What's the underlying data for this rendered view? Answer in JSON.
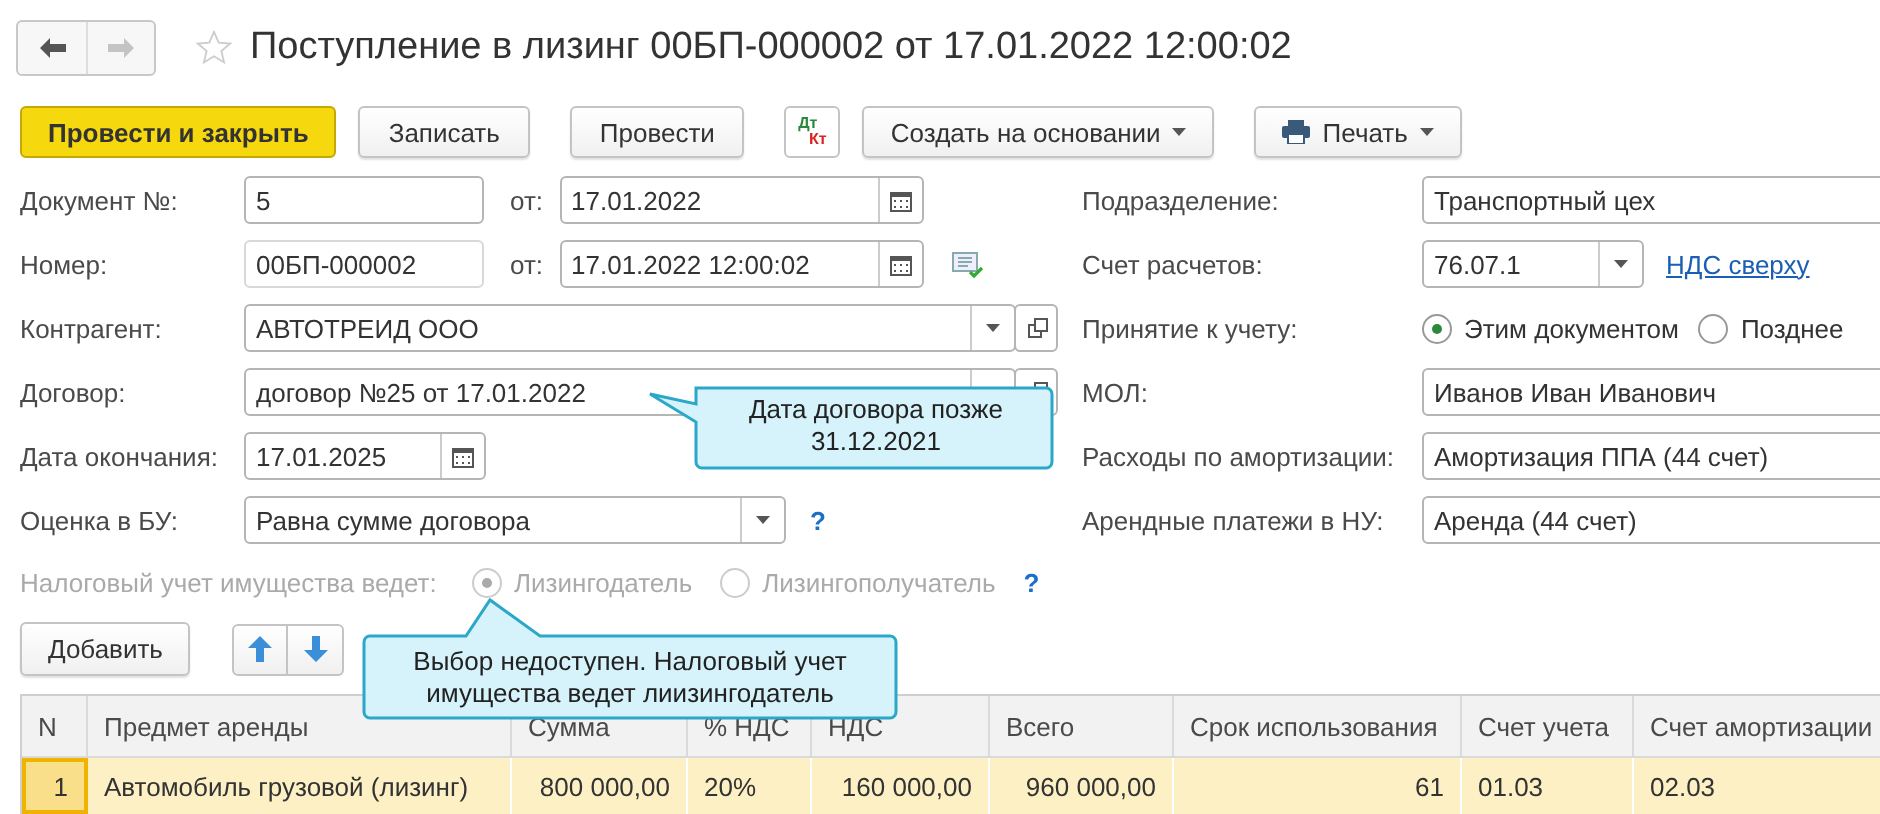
{
  "navigation": {
    "back_enabled": true,
    "forward_enabled": false
  },
  "favorite": false,
  "title": "Поступление в лизинг 00БП-000002 от 17.01.2022 12:00:02",
  "toolbar": [
    {
      "kind": "primary",
      "label": "Провести и закрыть"
    },
    {
      "kind": "plain",
      "label": "Записать"
    },
    {
      "kind": "plain",
      "label": "Провести"
    },
    {
      "kind": "dtkt",
      "lines": [
        "Дт",
        "Кт"
      ]
    },
    {
      "kind": "menu",
      "label": "Создать на основании"
    },
    {
      "kind": "print",
      "label": "Печать"
    }
  ],
  "left_fields": [
    {
      "kind": "doc_number",
      "label": "Документ №:",
      "value": "5",
      "date_label": "от:",
      "date": "17.01.2022"
    },
    {
      "kind": "number",
      "label": "Номер:",
      "value": "00БП-000002",
      "date_label": "от:",
      "date": "17.01.2022 12:00:02"
    },
    {
      "kind": "ref",
      "label": "Контрагент:",
      "value": "АВТОТРЕИД ООО"
    },
    {
      "kind": "ref",
      "label": "Договор:",
      "value": "договор №25 от 17.01.2022"
    },
    {
      "kind": "date",
      "label": "Дата окончания:",
      "value": "17.01.2025"
    },
    {
      "kind": "select",
      "label": "Оценка в БУ:",
      "value": "Равна сумме договора",
      "help": "?"
    }
  ],
  "right_fields": [
    {
      "kind": "input",
      "label": "Подразделение:",
      "value": "Транспортный цех"
    },
    {
      "kind": "select_link",
      "label": "Счет расчетов:",
      "value": "76.07.1",
      "link": "НДС сверху"
    },
    {
      "kind": "radio",
      "label": "Принятие к учету:",
      "options": [
        {
          "label": "Этим документом",
          "selected": true
        },
        {
          "label": "Позднее",
          "selected": false
        }
      ]
    },
    {
      "kind": "input",
      "label": "МОЛ:",
      "value": "Иванов Иван Иванович"
    },
    {
      "kind": "input",
      "label": "Расходы по амортизации:",
      "value": "Амортизация ППА (44 счет)"
    },
    {
      "kind": "input",
      "label": "Арендные платежи в НУ:",
      "value": "Аренда (44 счет)"
    }
  ],
  "tax_accounting": {
    "label": "Налоговый учет имущества ведет:",
    "disabled": true,
    "options": [
      {
        "label": "Лизингодатель",
        "selected": true
      },
      {
        "label": "Лизингополучатель",
        "selected": false
      }
    ],
    "help": "?"
  },
  "table_toolbar": {
    "add_button": "Добавить"
  },
  "table": {
    "columns": [
      "N",
      "Предмет аренды",
      "Сумма",
      "% НДС",
      "НДС",
      "Всего",
      "Срок использования",
      "Счет учета",
      "Счет амортизации"
    ],
    "rows": [
      {
        "selected": true,
        "cells": [
          "1",
          "Автомобиль грузовой (лизинг)",
          "800 000,00",
          "20%",
          "160 000,00",
          "960 000,00",
          "61",
          "01.03",
          "02.03"
        ]
      }
    ]
  },
  "tooltips": [
    {
      "kind": "contract",
      "text": "Дата договора позже 31.12.2021"
    },
    {
      "kind": "tax",
      "text": "Выбор недоступен. Налоговый учет имущества ведет лиизингодатель"
    }
  ]
}
